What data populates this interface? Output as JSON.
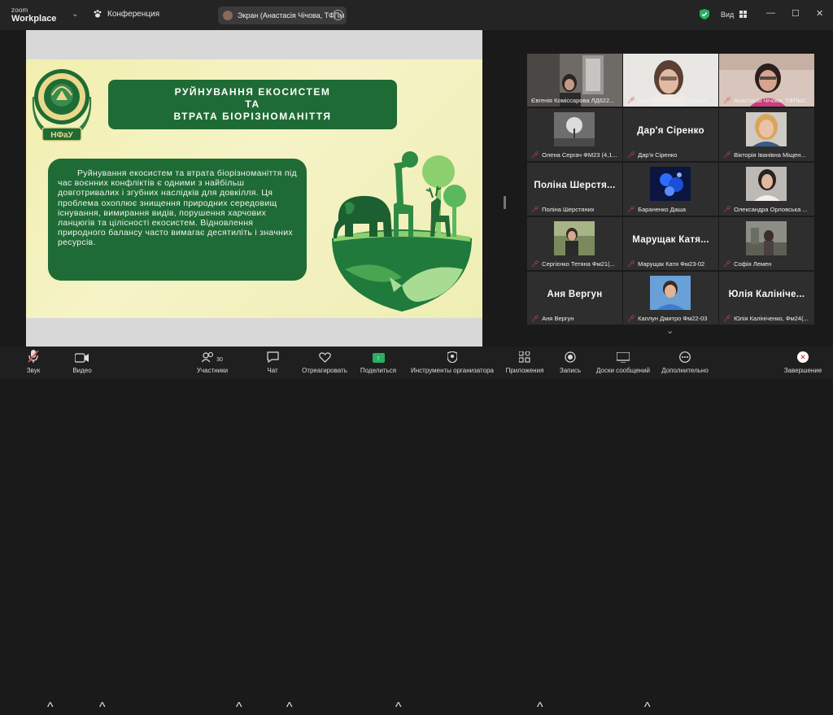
{
  "topbar": {
    "logo_line1": "zoom",
    "logo_line2": "Workplace",
    "conference_label": "Конференция",
    "screen_share_label": "Экран (Анастасія Чічова, ТФПм",
    "view_label": "Вид"
  },
  "slide": {
    "title_line1": "РУЙНУВАННЯ ЕКОСИСТЕМ",
    "title_line2": "ТА",
    "title_line3": "ВТРАТА БІОРІЗНОМАНІТТЯ",
    "body_text": "Руйнування екосистем та втрата біорізноманіття під час воєнних конфліктів є одними з найбільш довготривалих і згубних наслідків для довкілля. Ця проблема охоплює знищення природних середовищ існування, вимирання видів, порушення харчових ланцюгів та цілісності екосистем. Відновлення природного балансу часто вимагає десятиліть і значних ресурсів.",
    "emblem_text": "НФаУ"
  },
  "gallery": {
    "participants": [
      {
        "name": "Євгенія Комісcарова ЛД622...",
        "mode": "video",
        "muted": false
      },
      {
        "name": "Анастасія Рижук 1 група",
        "mode": "video",
        "muted": true
      },
      {
        "name": "Анастасія Чічова, ТФПм2...",
        "mode": "video",
        "muted": true
      },
      {
        "name": "Олена Сергач ФМ23 (4,1...",
        "mode": "photo",
        "muted": true
      },
      {
        "name": "Дар'я Сіренко",
        "big": "Дар'я Сіренко",
        "mode": "text",
        "muted": true
      },
      {
        "name": "Вікторія Іванівна Міщен...",
        "mode": "photo",
        "muted": true
      },
      {
        "name": "Поліна Шерстяних",
        "big": "Поліна Шерстя...",
        "mode": "text",
        "muted": true
      },
      {
        "name": "Бараненко Даша",
        "mode": "photo",
        "muted": true
      },
      {
        "name": "Олександра Орловська ...",
        "mode": "photo",
        "muted": true
      },
      {
        "name": "Сергієнко Тетяна Фм21(...",
        "mode": "photo",
        "muted": true
      },
      {
        "name": "Марущак Катя Фм23-02",
        "big": "Марущак Катя...",
        "mode": "text",
        "muted": true
      },
      {
        "name": "Софія Лемен",
        "mode": "photo",
        "muted": true
      },
      {
        "name": "Аня Вергун",
        "big": "Аня Вергун",
        "mode": "text",
        "muted": true
      },
      {
        "name": "Каплун Дмитро Фм22-03",
        "mode": "photo",
        "muted": true
      },
      {
        "name": "Юлія Калініченко, Фм24(...",
        "big": "Юлія Калініче...",
        "mode": "text",
        "muted": true
      }
    ]
  },
  "toolbar": {
    "audio": "Звук",
    "video": "Видео",
    "participants": "Участники",
    "participants_count": "30",
    "chat": "Чат",
    "react": "Отреагировать",
    "share": "Поделиться",
    "host_tools": "Инструменты организатора",
    "apps": "Приложения",
    "record": "Запись",
    "whiteboards": "Доски сообщений",
    "more": "Дополнительно",
    "end": "Завершение"
  },
  "colors": {
    "accent_green": "#27b060",
    "slide_green": "#1f6b35",
    "active_speaker": "#3ec17a",
    "muted_red": "#e04545"
  }
}
